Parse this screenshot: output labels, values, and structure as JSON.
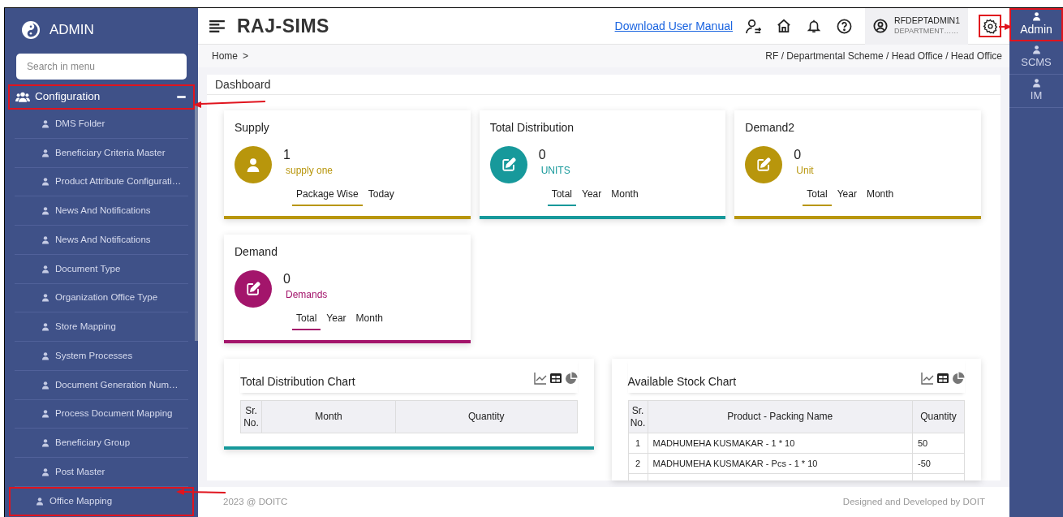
{
  "sidebar": {
    "title": "ADMIN",
    "search": {
      "placeholder": "Search in menu"
    },
    "group": {
      "label": "Configuration",
      "expanded": true,
      "highlighted": true,
      "items": [
        {
          "label": "DMS Folder",
          "highlighted": false
        },
        {
          "label": "Beneficiary Criteria Master",
          "highlighted": false
        },
        {
          "label": "Product Attribute Configurati…",
          "highlighted": false
        },
        {
          "label": "News And Notifications",
          "highlighted": false
        },
        {
          "label": "News And Notifications",
          "highlighted": false
        },
        {
          "label": "Document Type",
          "highlighted": false
        },
        {
          "label": "Organization Office Type",
          "highlighted": false
        },
        {
          "label": "Store Mapping",
          "highlighted": false
        },
        {
          "label": "System Processes",
          "highlighted": false
        },
        {
          "label": "Document Generation Num…",
          "highlighted": false
        },
        {
          "label": "Process Document Mapping",
          "highlighted": false
        },
        {
          "label": "Beneficiary Group",
          "highlighted": false
        },
        {
          "label": "Post Master",
          "highlighted": false
        },
        {
          "label": "Office Mapping",
          "highlighted": true
        }
      ]
    }
  },
  "header": {
    "title": "RAJ-SIMS",
    "manual_link": "Download User Manual",
    "user": {
      "name": "RFDEPTADMIN1",
      "role": "DEPARTMENT……"
    },
    "settings_highlighted": true
  },
  "breadcrumb": {
    "home": "Home",
    "sep": ">",
    "path": "RF / Departmental Scheme / Head Office / Head Office"
  },
  "rail": [
    {
      "label": "Admin",
      "selected": true,
      "highlighted": true
    },
    {
      "label": "SCMS",
      "selected": false,
      "highlighted": false
    },
    {
      "label": "IM",
      "selected": false,
      "highlighted": false
    }
  ],
  "dashboard": {
    "title": "Dashboard",
    "cards": [
      {
        "title": "Supply",
        "kind": "person",
        "value": "1",
        "unit": "supply one",
        "color": "#b8960c",
        "tabs": [
          {
            "label": "Package Wise",
            "selected": true
          },
          {
            "label": "Today",
            "selected": false
          }
        ]
      },
      {
        "title": "Total Distribution",
        "kind": "edit",
        "value": "0",
        "unit": "UNITS",
        "color": "#17999b",
        "tabs": [
          {
            "label": "Total",
            "selected": true
          },
          {
            "label": "Year",
            "selected": false
          },
          {
            "label": "Month",
            "selected": false
          }
        ]
      },
      {
        "title": "Demand2",
        "kind": "edit",
        "value": "0",
        "unit": "Unit",
        "color": "#b8960c",
        "tabs": [
          {
            "label": "Total",
            "selected": true
          },
          {
            "label": "Year",
            "selected": false
          },
          {
            "label": "Month",
            "selected": false
          }
        ]
      },
      {
        "title": "Demand",
        "kind": "edit",
        "value": "0",
        "unit": "Demands",
        "color": "#a3156b",
        "tabs": [
          {
            "label": "Total",
            "selected": true
          },
          {
            "label": "Year",
            "selected": false
          },
          {
            "label": "Month",
            "selected": false
          }
        ]
      }
    ],
    "charts": [
      {
        "title": "Total Distribution Chart",
        "columns": [
          "Sr. No.",
          "Month",
          "Quantity"
        ]
      },
      {
        "title": "Available Stock Chart",
        "columns": [
          "Sr. No.",
          "Product - Packing Name",
          "Quantity"
        ],
        "rows": [
          [
            "1",
            "MADHUMEHA KUSMAKAR - 1 * 10",
            "50"
          ],
          [
            "2",
            "MADHUMEHA KUSMAKAR - Pcs - 1 * 10",
            "-50"
          ]
        ]
      }
    ]
  },
  "footer": {
    "left": "2023 @ DOITC",
    "right": "Designed and Developed by DOIT"
  }
}
